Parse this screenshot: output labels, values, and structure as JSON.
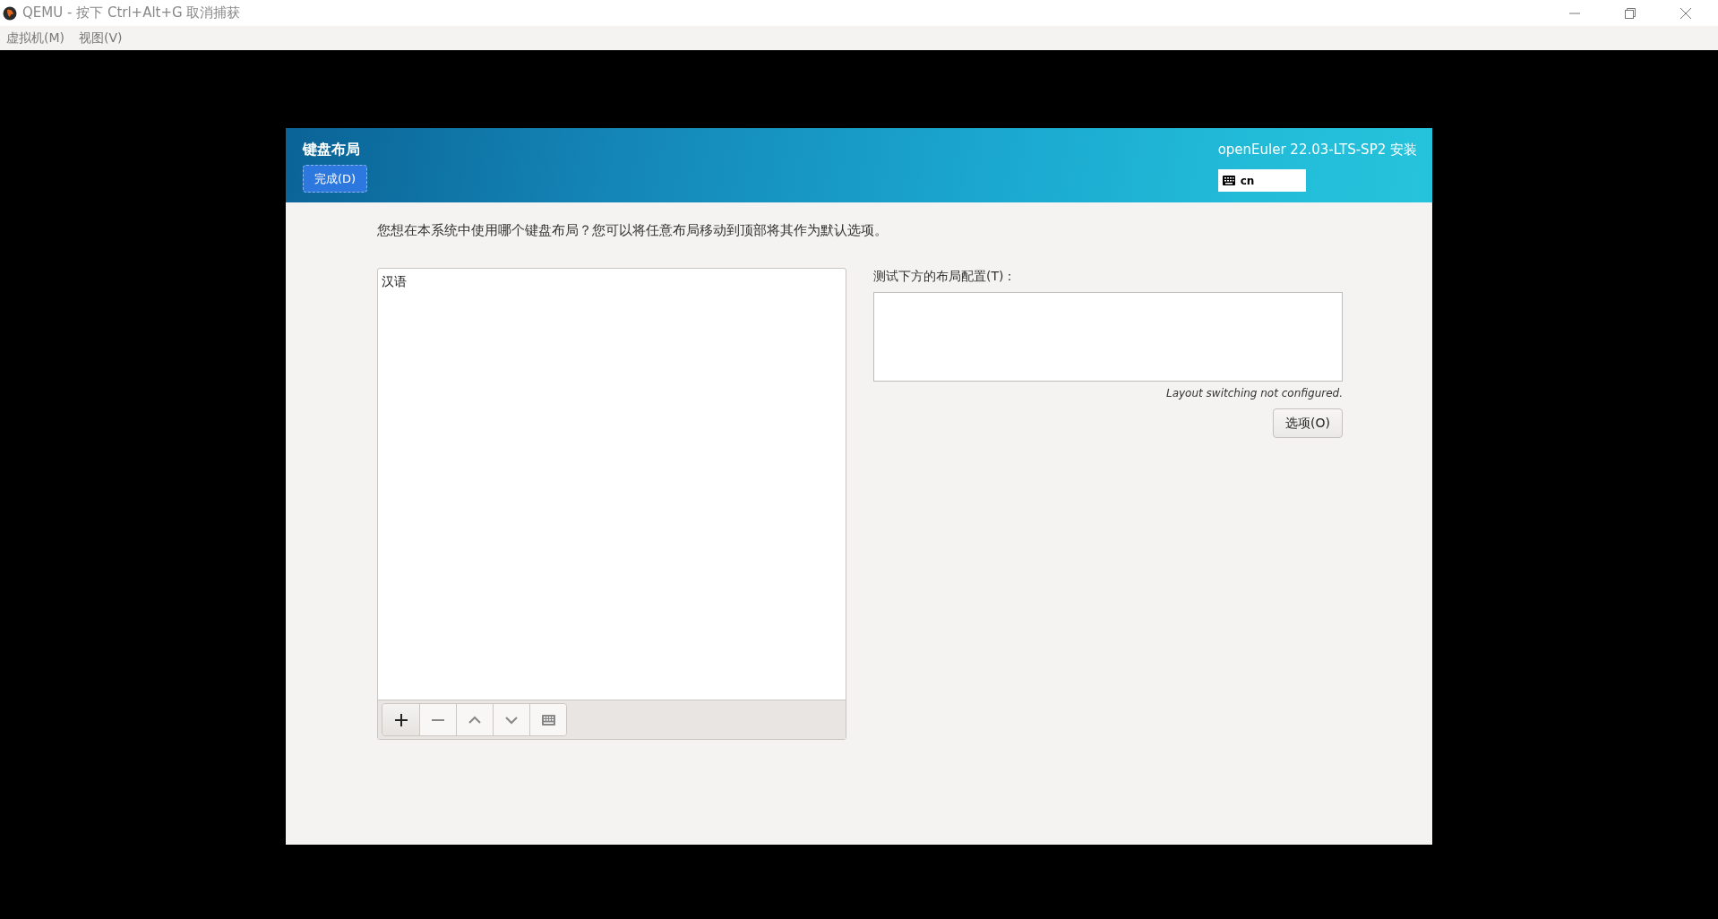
{
  "window": {
    "title": "QEMU - 按下 Ctrl+Alt+G 取消捕获"
  },
  "menu": [
    "虚拟机(M)",
    "视图(V)"
  ],
  "header": {
    "title": "键盘布局",
    "done_button": "完成(D)",
    "product": "openEuler 22.03-LTS-SP2 安装",
    "keyboard_indicator": "cn"
  },
  "question": "您想在本系统中使用哪个键盘布局？您可以将任意布局移动到顶部将其作为默认选项。",
  "layouts": [
    {
      "label": "汉语",
      "selected": false
    }
  ],
  "toolbar": [
    {
      "kind": "add"
    },
    {
      "kind": "remove"
    },
    {
      "kind": "up"
    },
    {
      "kind": "down"
    },
    {
      "kind": "preview"
    }
  ],
  "test": {
    "label": "测试下方的布局配置(T)：",
    "note": "Layout switching not configured.",
    "options_button": "选项(O)"
  }
}
